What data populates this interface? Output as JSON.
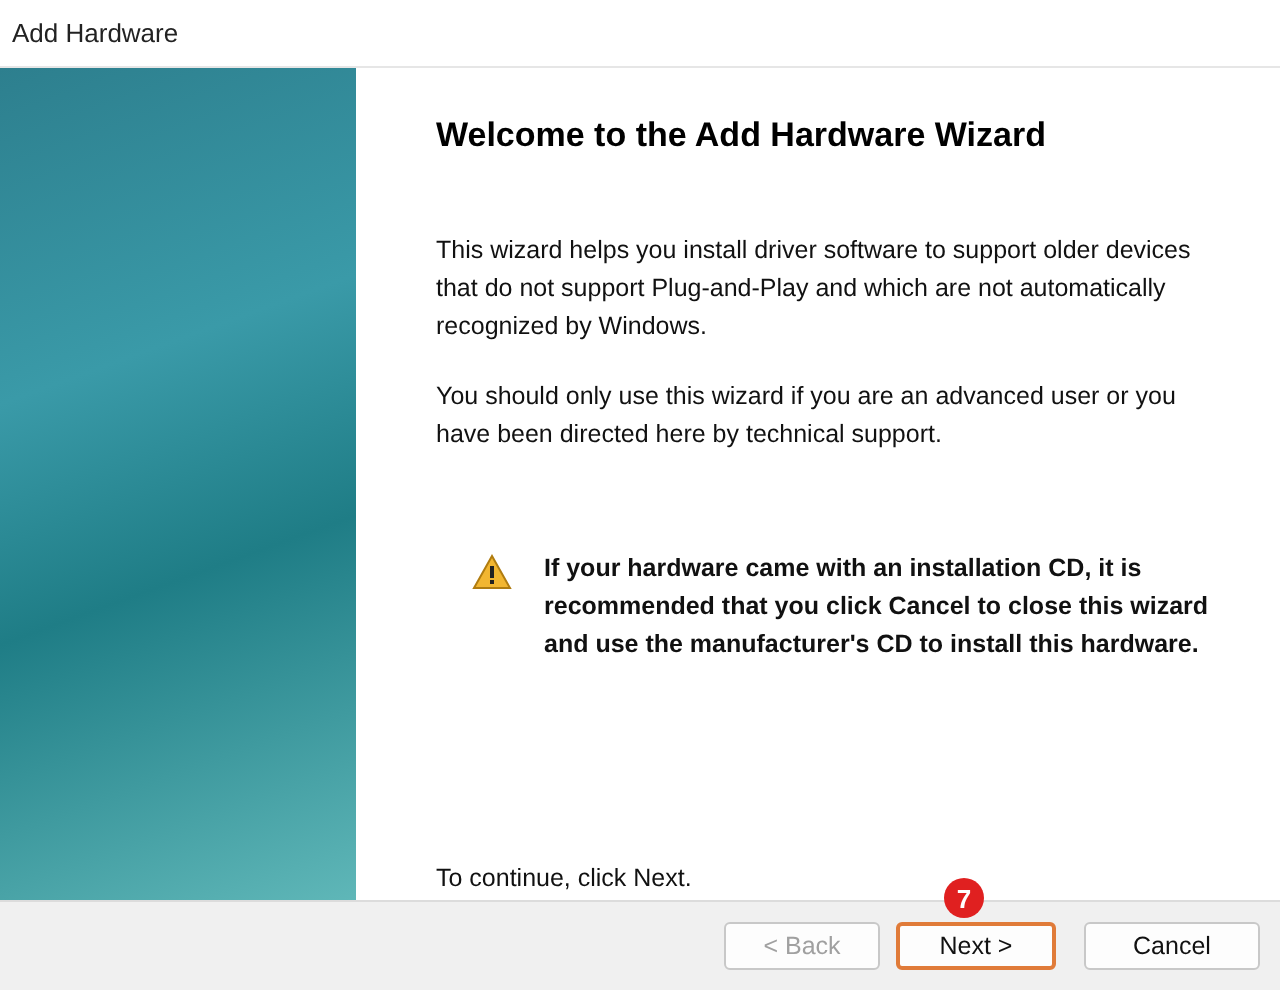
{
  "window": {
    "title": "Add Hardware"
  },
  "heading": "Welcome to the Add Hardware Wizard",
  "paragraphs": [
    "This wizard helps you install driver software to support older devices that do not support Plug-and-Play and which are not automatically recognized by Windows.",
    "You should only use this wizard if you are an advanced user or you have been directed here by technical support."
  ],
  "warning": "If your hardware came with an installation CD, it is recommended that you click Cancel to close this wizard and use the manufacturer's CD to install this hardware.",
  "continue_hint": "To continue, click Next.",
  "buttons": [
    {
      "label": "< Back",
      "disabled": true,
      "highlighted": false
    },
    {
      "label": "Next >",
      "disabled": false,
      "highlighted": true,
      "step_marker": "7"
    },
    {
      "label": "Cancel",
      "disabled": false,
      "highlighted": false
    }
  ]
}
